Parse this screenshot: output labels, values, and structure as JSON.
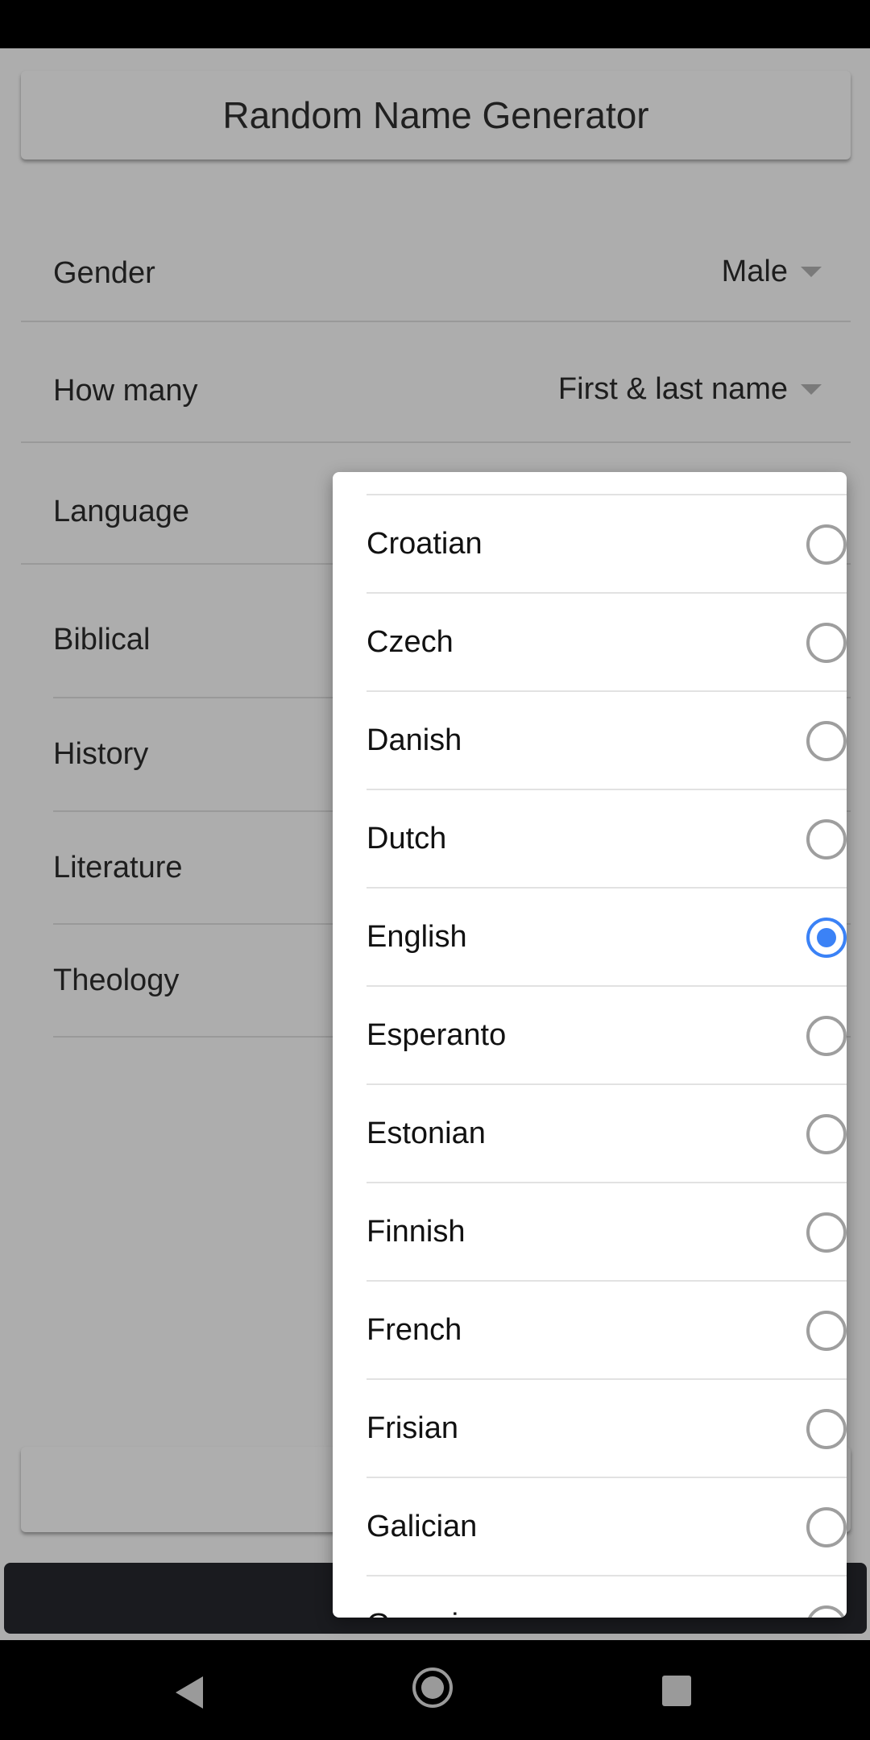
{
  "app": {
    "title": "Random Name Generator"
  },
  "settings": [
    {
      "label": "Gender",
      "value": "Male"
    },
    {
      "label": "How many",
      "value": "First & last name"
    },
    {
      "label": "Language",
      "value": ""
    }
  ],
  "categories": [
    {
      "label": "Biblical"
    },
    {
      "label": "History"
    },
    {
      "label": "Literature"
    },
    {
      "label": "Theology"
    }
  ],
  "language_dialog": {
    "selected": "English",
    "accent_color": "#3b82f6",
    "options": [
      "Croatian",
      "Czech",
      "Danish",
      "Dutch",
      "English",
      "Esperanto",
      "Estonian",
      "Finnish",
      "French",
      "Frisian",
      "Galician",
      "Georgian"
    ]
  },
  "navbar": {
    "icons": [
      "back-icon",
      "home-icon",
      "recent-apps-icon"
    ]
  }
}
